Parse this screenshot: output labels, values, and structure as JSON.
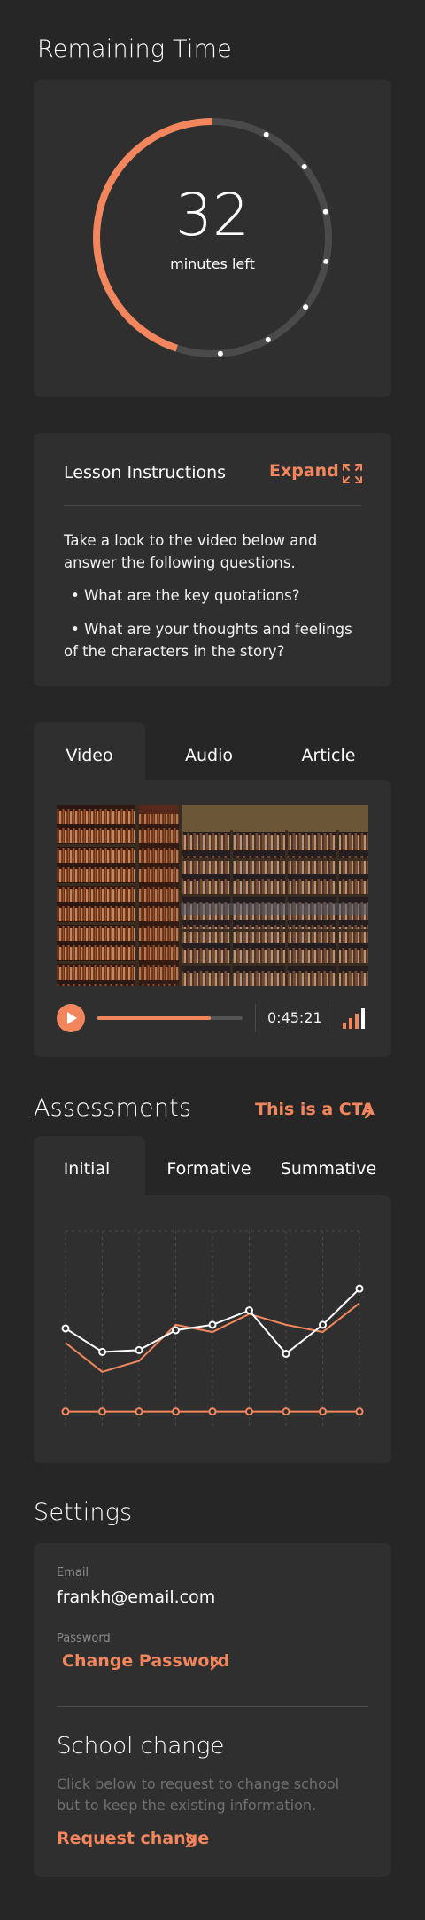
{
  "remaining_time": {
    "title": "Remaining Time",
    "minutes": "32",
    "unit_label": "minutes left",
    "progress_fraction": 0.45
  },
  "instructions": {
    "title": "Lesson Instructions",
    "expand_label": "Expand",
    "intro": "Take a look to the video below and answer the following questions.",
    "bullets": [
      "What are the key quotations?",
      "What are your thoughts and feelings of the characters in the story?"
    ]
  },
  "media": {
    "tabs": [
      "Video",
      "Audio",
      "Article"
    ],
    "active_tab": "Video",
    "time": "0:45:21",
    "progress_fraction": 0.78
  },
  "assessments": {
    "title": "Assessments",
    "cta_label": "This is a CTA",
    "tabs": [
      "Initial",
      "Formative",
      "Summative"
    ],
    "active_tab": "Initial"
  },
  "chart_data": {
    "type": "line",
    "x": [
      1,
      2,
      3,
      4,
      5,
      6,
      7,
      8,
      9
    ],
    "series": [
      {
        "values": [
          38,
          22,
          28,
          48,
          44,
          54,
          48,
          44,
          60
        ],
        "color": "#f3865c"
      },
      {
        "values": [
          46,
          33,
          34,
          45,
          48,
          56,
          32,
          48,
          68
        ],
        "color": "#ffffff"
      },
      {
        "values": [
          0,
          0,
          0,
          0,
          0,
          0,
          0,
          0,
          0
        ],
        "color": "#f3865c"
      }
    ],
    "ylim": [
      -10,
      100
    ],
    "grid": true
  },
  "settings": {
    "title": "Settings",
    "email_label": "Email",
    "email": "frankh@email.com",
    "password_label": "Password",
    "change_password_label": "Change Password",
    "school_title": "School change",
    "school_desc": "Click below to request to change school but to keep the existing information.",
    "request_label": "Request change"
  },
  "colors": {
    "accent": "#f3865c",
    "background": "#262626",
    "card": "#2f2f2f"
  }
}
